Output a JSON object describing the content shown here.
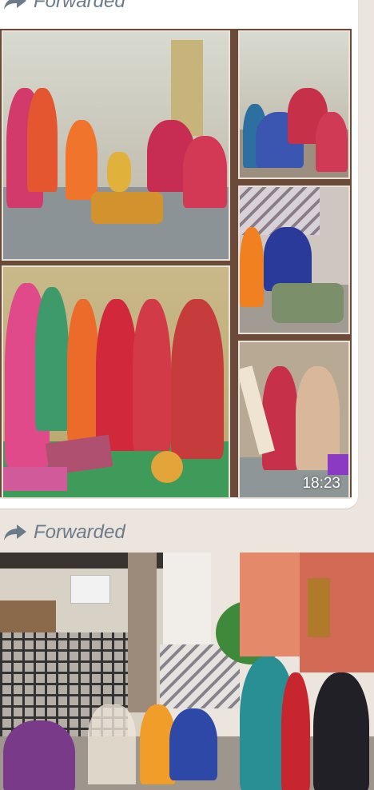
{
  "message1": {
    "forwarded_label": "Forwarded",
    "timestamp": "18:23",
    "image_description_icon": "photo-collage"
  },
  "message2": {
    "forwarded_label": "Forwarded",
    "image_icon": "photo"
  },
  "colors": {
    "chat_background": "#ece5dd",
    "bubble": "#ffffff",
    "forwarded_text": "#6b7b8a",
    "collage_frame": "#6b4a3a"
  }
}
